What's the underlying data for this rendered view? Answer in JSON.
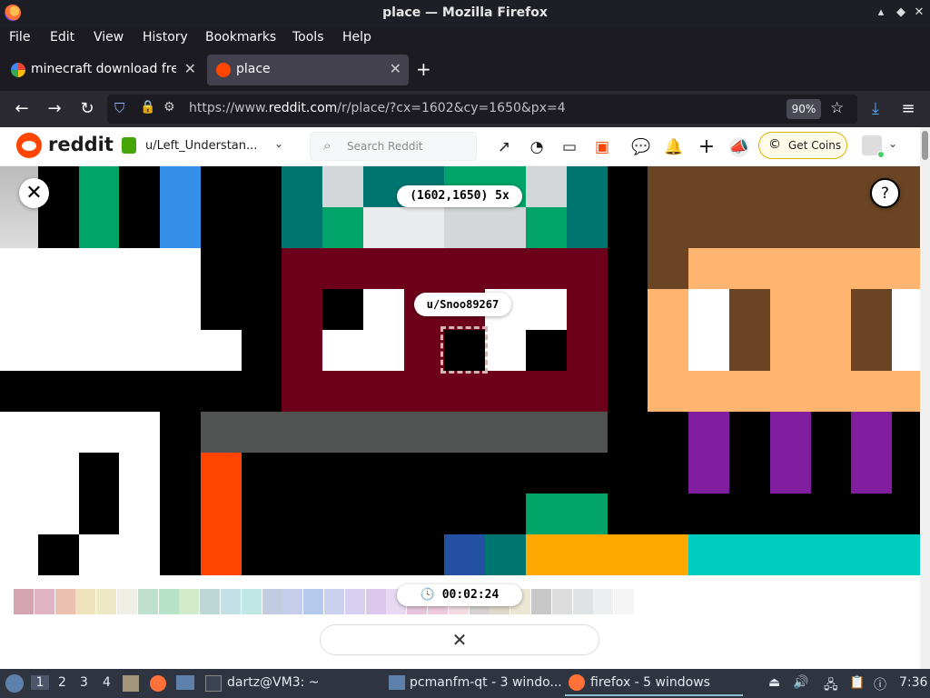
{
  "window": {
    "title": "place — Mozilla Firefox",
    "controls": [
      "▴",
      "◆",
      "✕"
    ]
  },
  "menu": [
    "File",
    "Edit",
    "View",
    "History",
    "Bookmarks",
    "Tools",
    "Help"
  ],
  "tabs": [
    {
      "label": "minecraft download free",
      "favicon": "google-icon",
      "active": false
    },
    {
      "label": "place",
      "favicon": "reddit-icon",
      "active": true
    }
  ],
  "new_tab": "+",
  "navbar": {
    "url_prefix": "https://www.",
    "url_host": "reddit.com",
    "url_path": "/r/place/?cx=1602&cy=1650&px=4",
    "zoom": "90%"
  },
  "reddit_header": {
    "logo_text": "reddit",
    "user": "u/Left_Understan...",
    "search_placeholder": "Search Reddit",
    "get_coins": "Get Coins"
  },
  "place": {
    "coordinates": "(1602,1650) 5x",
    "hover_user": "u/Snoo89267",
    "timer": "00:02:24",
    "close_symbol": "✕",
    "help_symbol": "?",
    "palette_colors": [
      "#d4a5b0",
      "#e0b3c2",
      "#ecc0b0",
      "#efe1bc",
      "#ede9c6",
      "#f0efe6",
      "#bfe0cf",
      "#b9e3c8",
      "#d2ebc9",
      "#bdd6d6",
      "#c2e0e6",
      "#c0e6e6",
      "#c3cde2",
      "#c5cdea",
      "#b5c9ed",
      "#c9d1ee",
      "#d6cfef",
      "#dcc8ea",
      "#e7d9f2",
      "#e6c6de",
      "#edcadd",
      "#f2dde2",
      "#d7d2d2",
      "#e3d8cc",
      "#ece6d5",
      "#c7c7c7",
      "#dcdcdc",
      "#e0e3e6",
      "#eceef0",
      "#f5f5f5"
    ]
  },
  "taskbar": {
    "workspaces": [
      "1",
      "2",
      "3",
      "4"
    ],
    "terminal": "dartz@VM3: ~",
    "files": "pcmanfm-qt - 3 windo...",
    "firefox": "firefox - 5 windows",
    "clock": "7:36"
  }
}
